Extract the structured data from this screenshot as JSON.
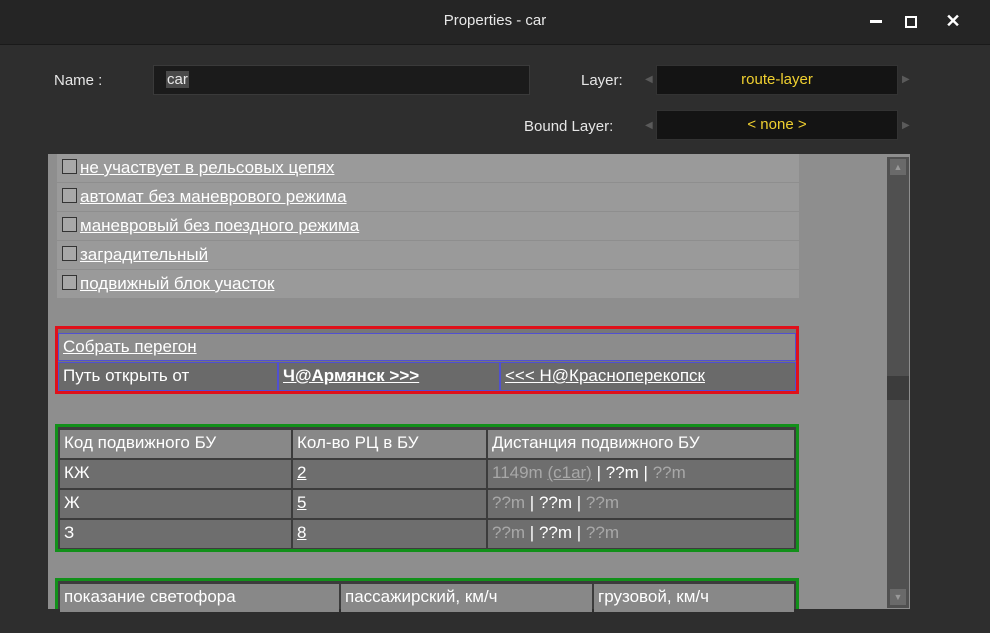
{
  "window": {
    "title": "Properties - car"
  },
  "form": {
    "name_label": "Name :",
    "name_value": "car",
    "layer_label": "Layer:",
    "layer_value": "route-layer",
    "bound_layer_label": "Bound Layer:",
    "bound_layer_value": "< none >"
  },
  "checkboxes": [
    "не участвует в рельсовых цепях",
    "автомат без маневрового режима",
    "маневровый без поездного режима",
    "заградительный",
    "подвижный блок участок"
  ],
  "peregon": {
    "title": "Собрать перегон",
    "path_label": "Путь открыть от",
    "from": "Ч@Армянск  >>>",
    "to": "<<< Н@Красноперекопск"
  },
  "block_table": {
    "headers": [
      "Код подвижного БУ",
      "Кол-во РЦ в БУ",
      "Дистанция подвижного БУ"
    ],
    "rows": [
      {
        "code": "КЖ",
        "count": "2",
        "d1": "1149m",
        "d1_link": "(c1ar)",
        "sep1": " | ",
        "d2": "??m",
        "sep2": " | ",
        "d3": "??m"
      },
      {
        "code": "Ж",
        "count": "5",
        "d1": "??m",
        "d1_link": "",
        "sep1": " | ",
        "d2": "??m",
        "sep2": " | ",
        "d3": "??m"
      },
      {
        "code": "З",
        "count": "8",
        "d1": "??m",
        "d1_link": "",
        "sep1": " | ",
        "d2": "??m",
        "sep2": " | ",
        "d3": "??m"
      }
    ]
  },
  "speed_table": {
    "headers": [
      "показание светофора",
      "пассажирский, км/ч",
      "грузовой, км/ч"
    ]
  },
  "colors": {
    "red_border": "#e0101a",
    "green_border": "#12901a",
    "accent_yellow": "#f0d030"
  }
}
